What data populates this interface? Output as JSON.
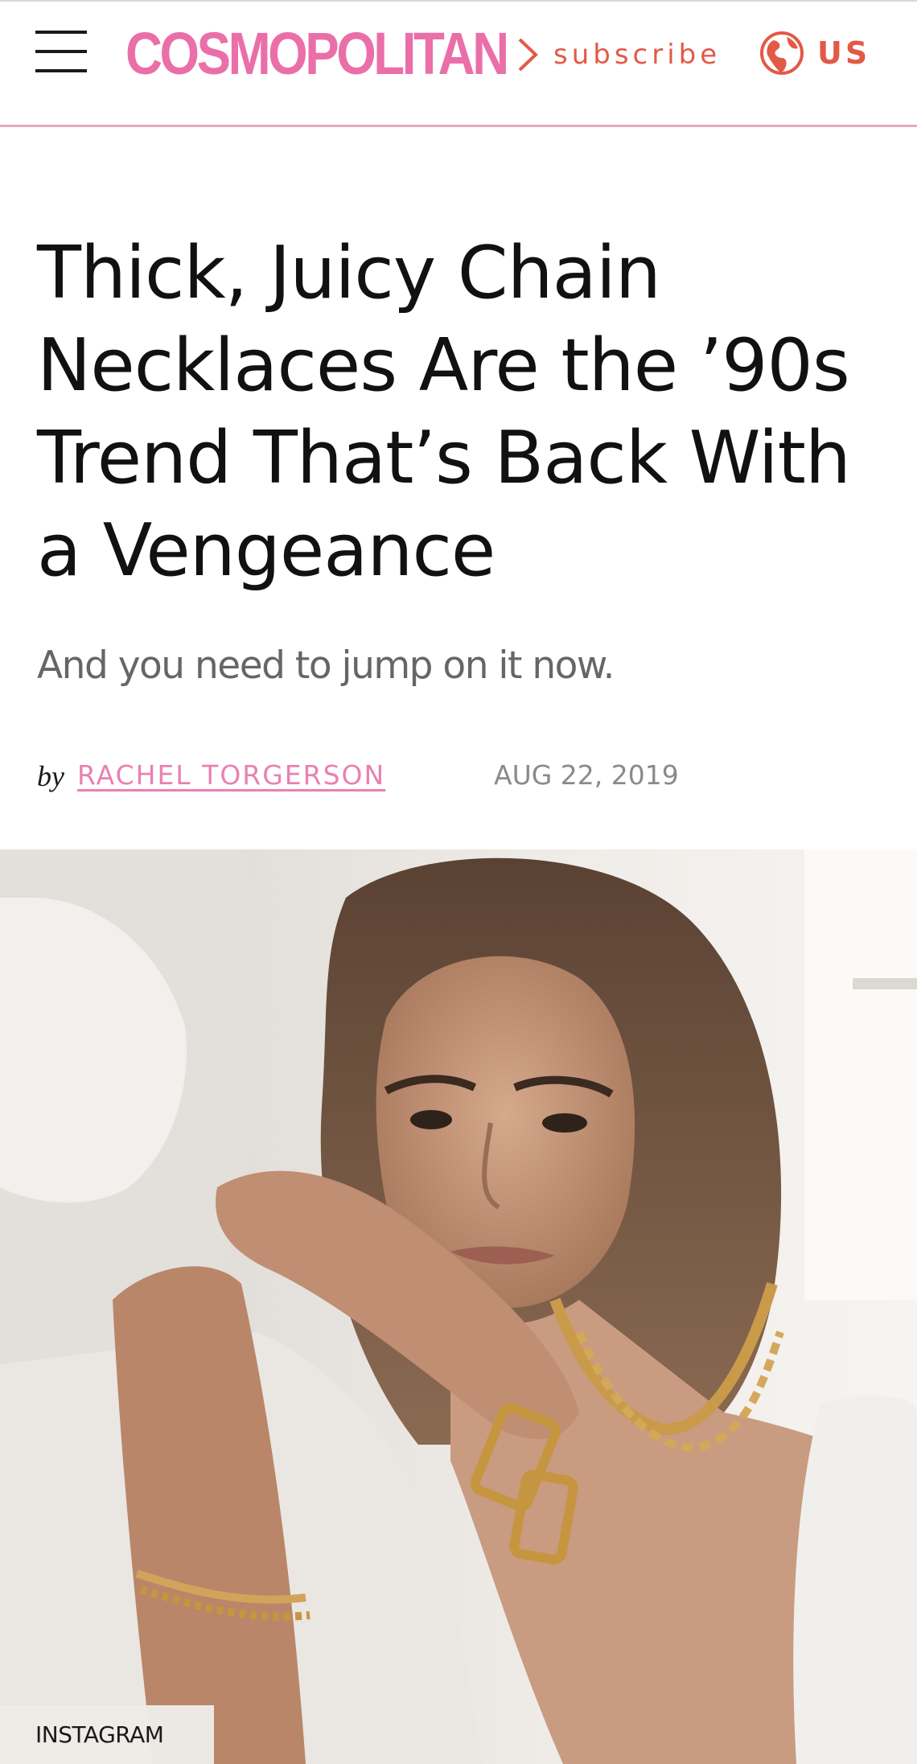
{
  "header": {
    "logo": "COSMOPOLITAN",
    "subscribe_label": "subscribe",
    "region_label": "US",
    "accent_color": "#e25a47",
    "brand_color": "#ea6fa9"
  },
  "article": {
    "headline": "Thick, Juicy Chain Necklaces Are the ’90s Trend That’s Back With a Vengeance",
    "dek": "And you need to jump on it now.",
    "byline_prefix": "by",
    "author": "RACHEL TORGERSON",
    "date": "AUG 22, 2019"
  },
  "hero": {
    "credit": "INSTAGRAM"
  }
}
